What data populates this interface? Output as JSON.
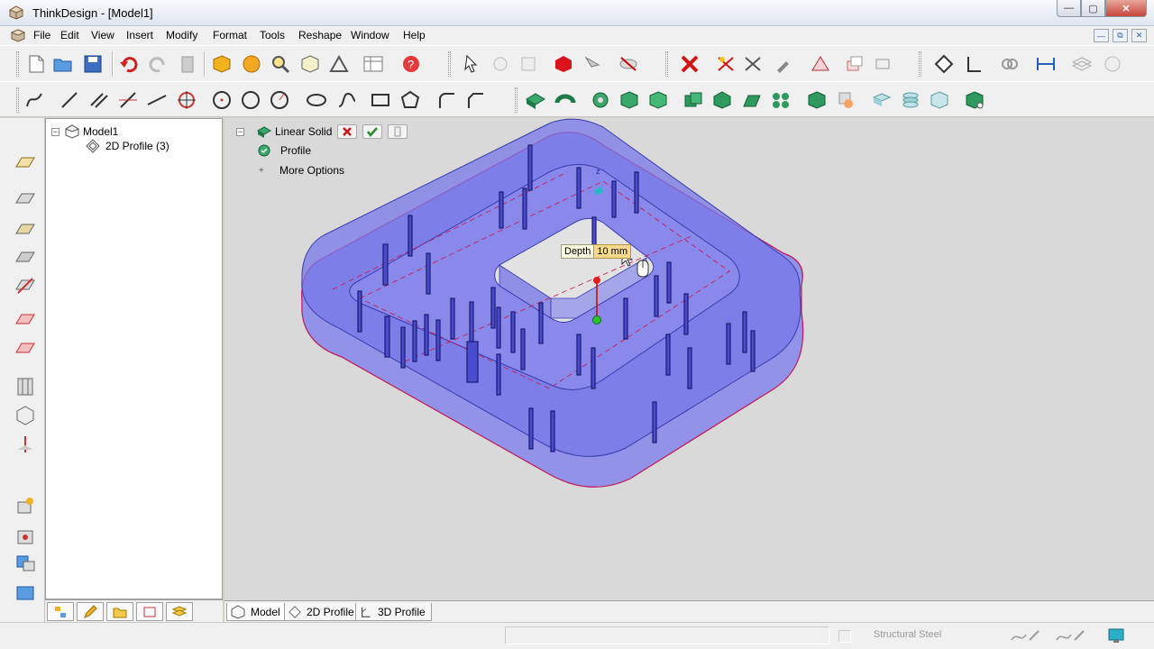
{
  "window": {
    "title": "ThinkDesign  - [Model1]"
  },
  "menu": [
    {
      "label": "File",
      "key": "F"
    },
    {
      "label": "Edit",
      "key": "E"
    },
    {
      "label": "View",
      "key": "V"
    },
    {
      "label": "Insert",
      "key": "I"
    },
    {
      "label": "Modify",
      "key": "M"
    },
    {
      "label": "Format",
      "key": "o"
    },
    {
      "label": "Tools",
      "key": "T"
    },
    {
      "label": "Reshape",
      "key": "R"
    },
    {
      "label": "Window",
      "key": "W"
    },
    {
      "label": "Help",
      "key": "H"
    }
  ],
  "tree": {
    "root": "Model1",
    "child": "2D Profile (3)"
  },
  "command": {
    "name": "Linear Solid",
    "profile_label": "Profile",
    "more_options": "More Options",
    "depth_label": "Depth",
    "depth_value": "10 mm"
  },
  "view_tabs": [
    {
      "label": "Model"
    },
    {
      "label": "2D Profile"
    },
    {
      "label": "3D Profile"
    }
  ],
  "status": {
    "material": "Structural Steel"
  },
  "colors": {
    "solid_fill": "#7a7ae6",
    "solid_edge": "#c0185a",
    "viewport_bg": "#d9d9d9"
  }
}
